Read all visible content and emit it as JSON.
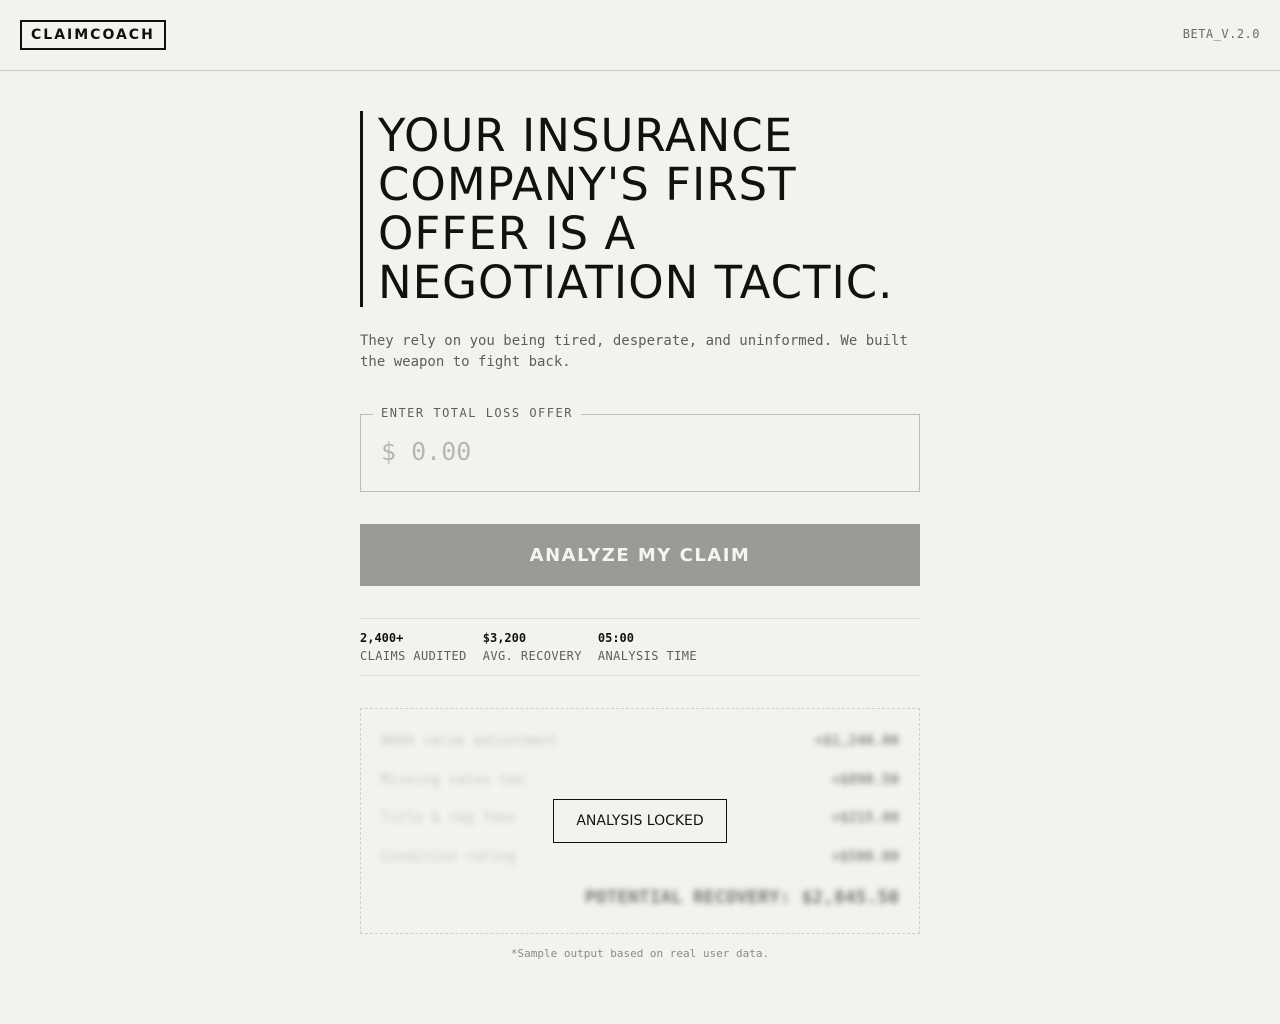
{
  "header": {
    "logo": "CLAIMCOACH",
    "version": "BETA_V.2.0"
  },
  "hero": {
    "headline": "YOUR INSURANCE COMPANY'S FIRST OFFER IS A NEGOTIATION TACTIC.",
    "subtext": "They rely on you being tired, desperate, and uninformed. We built the weapon to fight back."
  },
  "offer_field": {
    "legend": "ENTER TOTAL LOSS OFFER",
    "placeholder": "$ 0.00",
    "value": ""
  },
  "analyze_button": {
    "label": "ANALYZE MY CLAIM"
  },
  "stats": [
    {
      "value": "2,400+",
      "label": "CLAIMS AUDITED"
    },
    {
      "value": "$3,200",
      "label": "AVG. RECOVERY"
    },
    {
      "value": "05:00",
      "label": "ANALYSIS TIME"
    }
  ],
  "preview": {
    "rows": [
      {
        "label": "NADA value adjustment",
        "amount": "+$1,240.00"
      },
      {
        "label": "Missing sales tax",
        "amount": "+$890.50"
      },
      {
        "label": "Title & reg fees",
        "amount": "+$215.00"
      },
      {
        "label": "Condition rating",
        "amount": "+$500.00"
      }
    ],
    "total": "POTENTIAL RECOVERY: $2,845.50",
    "locked_label": "ANALYSIS LOCKED"
  },
  "footnote": "*Sample output based on real user data."
}
